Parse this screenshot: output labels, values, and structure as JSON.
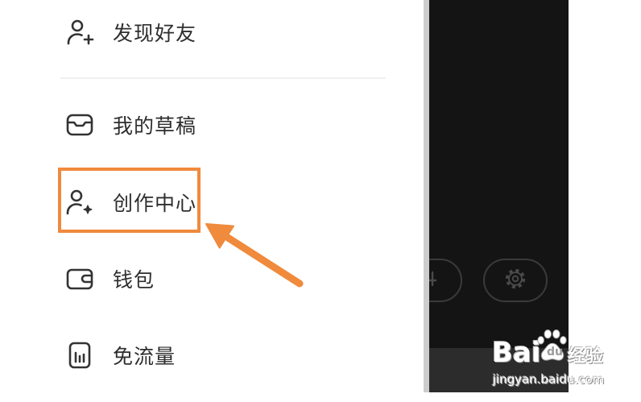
{
  "menu": {
    "items": [
      {
        "label": "发现好友",
        "icon": "person-plus-icon"
      },
      {
        "label": "我的草稿",
        "icon": "drafts-inbox-icon"
      },
      {
        "label": "创作中心",
        "icon": "creator-center-icon"
      },
      {
        "label": "钱包",
        "icon": "wallet-icon"
      },
      {
        "label": "免流量",
        "icon": "free-data-icon"
      }
    ],
    "highlighted_index": 2
  },
  "background_panel": {
    "buttons": [
      {
        "icon": "partial-icon"
      },
      {
        "icon": "gear-icon"
      }
    ]
  },
  "watermark": {
    "brand_left": "Bai",
    "brand_paw": "du",
    "brand_right": "经验",
    "url": "jingyan.baidu.com",
    "paw_icon": "baidu-paw-icon"
  },
  "colors": {
    "menu_text": "#2e2e2e",
    "menu_icon": "#333333",
    "highlight": "#f08a3c",
    "arrow": "#f08a3c",
    "dark_panel": "#141414",
    "background": "#ffffff"
  }
}
